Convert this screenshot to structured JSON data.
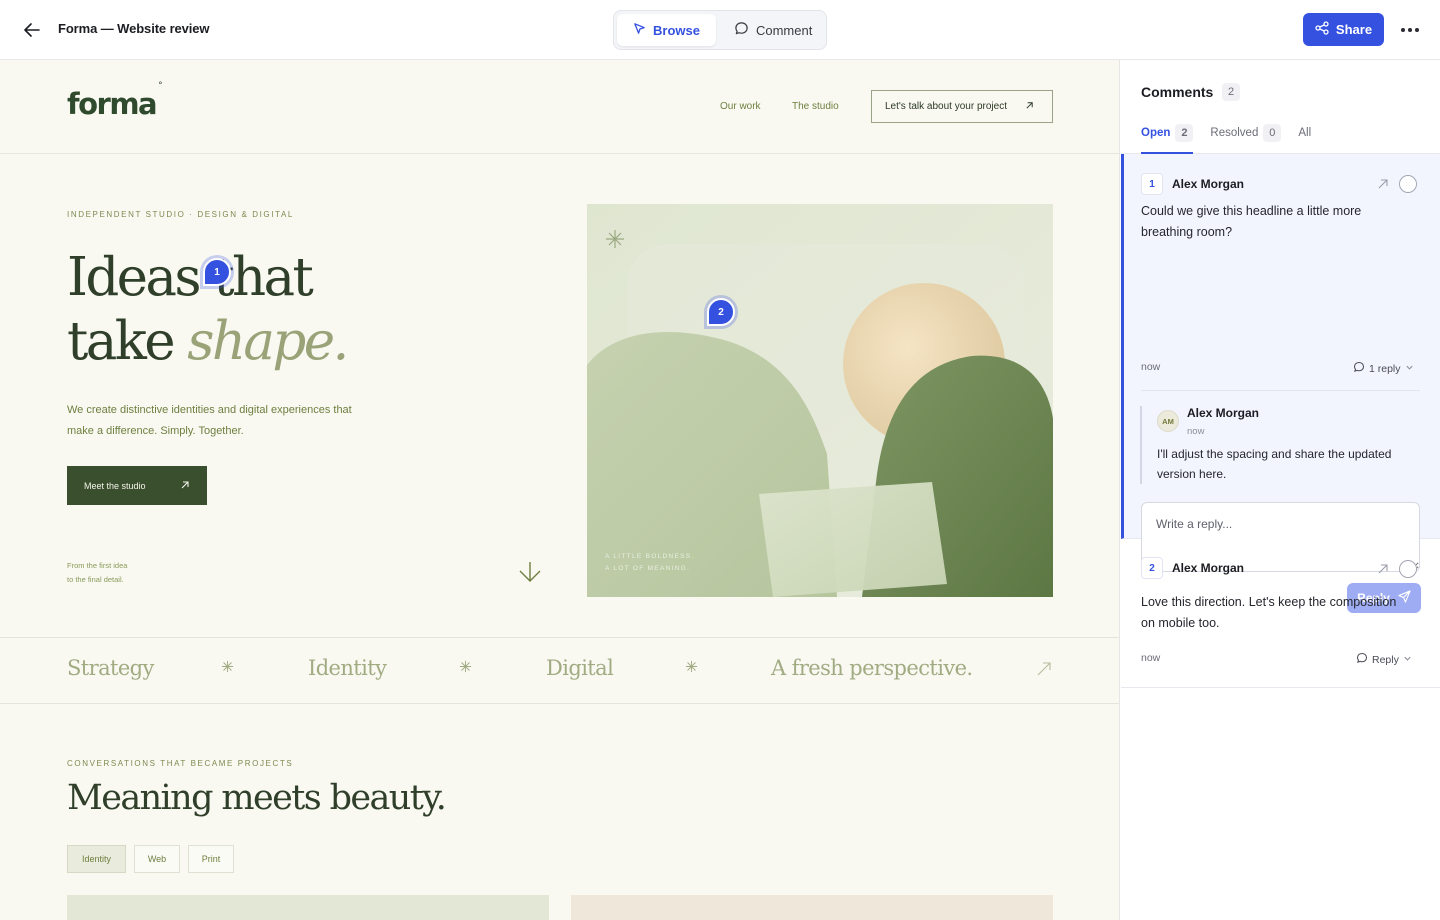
{
  "topbar": {
    "title": "Forma — Website review",
    "modes": [
      {
        "label": "Browse",
        "active": true,
        "icon": "cursor-icon"
      },
      {
        "label": "Comment",
        "active": false,
        "icon": "comment-icon"
      }
    ],
    "share_label": "Share"
  },
  "site": {
    "logo": "forma",
    "logo_mark": "°",
    "nav": [
      "Our work",
      "The studio"
    ],
    "cta": "Let's talk about your project",
    "eyebrow": "INDEPENDENT STUDIO · DESIGN & DIGITAL",
    "headline_line1": "Ideas that",
    "headline_line2_plain": "take ",
    "headline_line2_italic": "shape.",
    "intro": "We create distinctive identities and digital experiences that make a difference. Simply. Together.",
    "button": "Meet the studio",
    "note_line1": "From the first idea",
    "note_line2": "to the final detail.",
    "art_caption_line1": "A LITTLE BOLDNESS.",
    "art_caption_line2": "A LOT OF MEANING.",
    "strip": [
      "Strategy",
      "Identity",
      "Digital",
      "A fresh perspective."
    ],
    "section_eyebrow": "CONVERSATIONS THAT BECAME PROJECTS",
    "section_title": "Meaning meets beauty.",
    "filters": [
      {
        "label": "Identity",
        "active": true
      },
      {
        "label": "Web",
        "active": false
      },
      {
        "label": "Print",
        "active": false
      }
    ],
    "pins": [
      "1",
      "2"
    ]
  },
  "comments": {
    "title": "Comments",
    "total": "2",
    "tabs": [
      {
        "label": "Open",
        "count": "2",
        "active": true
      },
      {
        "label": "Resolved",
        "count": "0",
        "active": false
      },
      {
        "label": "All",
        "count": "",
        "active": false
      }
    ],
    "threads": [
      {
        "num": "1",
        "author": "Alex Morgan",
        "body": "Could we give this headline a little more breathing room?",
        "time": "now",
        "reply_label": "1 reply",
        "replies": [
          {
            "initials": "AM",
            "author": "Alex Morgan",
            "time": "now",
            "body": "I'll adjust the spacing and share the updated version here."
          }
        ],
        "input_placeholder": "Write a reply...",
        "reply_button": "Reply"
      },
      {
        "num": "2",
        "author": "Alex Morgan",
        "body": "Love this direction. Let's keep the composition on mobile too.",
        "time": "now",
        "reply_label": "Reply"
      }
    ]
  },
  "colors": {
    "accent": "#3451e0",
    "site_bg": "#f9f9f2",
    "brand_green": "#2f4a2c"
  }
}
